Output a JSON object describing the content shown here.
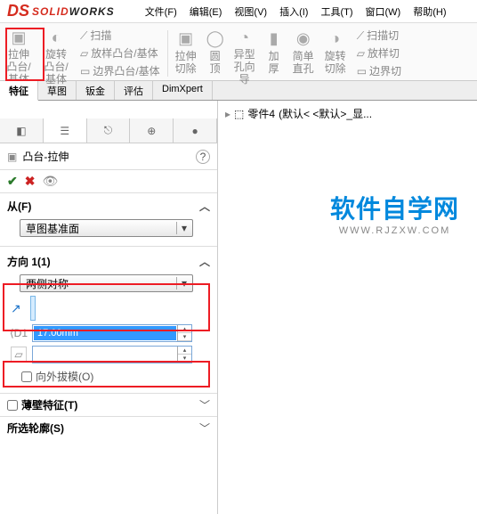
{
  "app": {
    "logo_prefix": "SOLID",
    "logo_suffix": "WORKS"
  },
  "menu": [
    "文件(F)",
    "编辑(E)",
    "视图(V)",
    "插入(I)",
    "工具(T)",
    "窗口(W)",
    "帮助(H)"
  ],
  "ribbon": {
    "extrude": "拉伸凸台/基体",
    "revolve": "旋转凸台/基体",
    "sweep": "扫描",
    "loft": "放样凸台/基体",
    "boundary": "边界凸台/基体",
    "extrude_cut": "拉伸切除",
    "fillet": "圆顶",
    "hole": "异型孔向导",
    "thicken": "加厚",
    "simple": "简单直孔",
    "revolve_cut": "旋转切除",
    "sweep_cut": "扫描切",
    "loft_cut": "放样切",
    "boundary_cut": "边界切"
  },
  "tabs": [
    "特征",
    "草图",
    "钣金",
    "评估",
    "DimXpert"
  ],
  "crumb": {
    "part": "零件4",
    "state": "(默认< <默认>_显..."
  },
  "feature": {
    "title": "凸台-拉伸",
    "from_label": "从(F)",
    "from_value": "草图基准面",
    "dir_label": "方向 1(1)",
    "dir_value": "两侧对称",
    "depth": "17.00mm",
    "outward": "向外拔模(O)",
    "thin": "薄壁特征(T)",
    "contour": "所选轮廓(S)"
  },
  "watermark": {
    "l1": "软件自学网",
    "l2": "WWW.RJZXW.COM"
  }
}
